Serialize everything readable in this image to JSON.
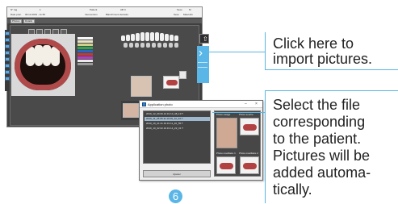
{
  "app": {
    "info_bar": {
      "field1_label": "N° log",
      "field1_value": "1",
      "field2_label": "Patient",
      "field2_value": "AB C",
      "field3_label": "Sexe",
      "field3_value": "M",
      "field4_label": "Date préc.",
      "field4_value": "09.12.2019 - 11:35",
      "field5_label": "Intervention",
      "field5_value": "Blanchiment dentaire",
      "field6_label": "Sexe",
      "field6_value": "Masculin"
    },
    "tabs": [
      "Photos",
      "Détails"
    ]
  },
  "dialog": {
    "title": "Application photo",
    "files": [
      "2019_12_09 09.12.19 10_48_19 T",
      "2019_11_05 05.11.19 09_12_04 T",
      "2019_10_21 21.10.19 11_40_55 T",
      "2019_10_02 02.10.19 14_22_31 T"
    ],
    "selected_index": 1,
    "preview_labels": [
      "Photo visage",
      "Photo sourire",
      "Photo maxillaire 1",
      "Photo maxillaire 2"
    ],
    "button_label": "Ajouter"
  },
  "callouts": {
    "import": [
      "Click here to",
      "import pictures."
    ],
    "select": [
      "Select the file",
      "corresponding",
      "to the patient.",
      "Pictures will be",
      "added automa-",
      "tically."
    ]
  },
  "step_number": "6",
  "colors": {
    "accent": "#5ab6e6",
    "app_background": "#3f3f3f",
    "tool_blue": "#6aa6d6"
  },
  "icons": {
    "upload": "upload-arrow-icon",
    "import": "chevron-right-icon"
  }
}
